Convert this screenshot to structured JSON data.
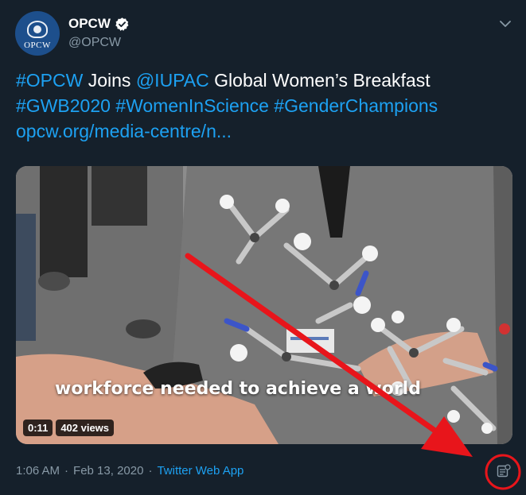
{
  "account": {
    "avatar_text": "OPCW",
    "display_name": "OPCW",
    "handle": "@OPCW"
  },
  "tweet": {
    "line1_hashtag": "#OPCW",
    "line1_joins": " Joins ",
    "line1_mention": "@IUPAC",
    "line1_rest": " Global Women’s Breakfast",
    "line2": "#GWB2020 #WomenInScience #GenderChampions",
    "line3": "opcw.org/media-centre/n..."
  },
  "video": {
    "caption": "workforce needed to achieve a world",
    "time": "0:11",
    "views": "402 views"
  },
  "footer": {
    "time": "1:06 AM",
    "separator": "·",
    "date": "Feb 13, 2020",
    "source": "Twitter Web App"
  },
  "colors": {
    "background": "#15202b",
    "link": "#1da1f2",
    "muted": "#8899a6",
    "annotation": "#e8151b"
  },
  "icons": [
    "verified-badge-icon",
    "chevron-down-icon",
    "analytics-icon"
  ]
}
